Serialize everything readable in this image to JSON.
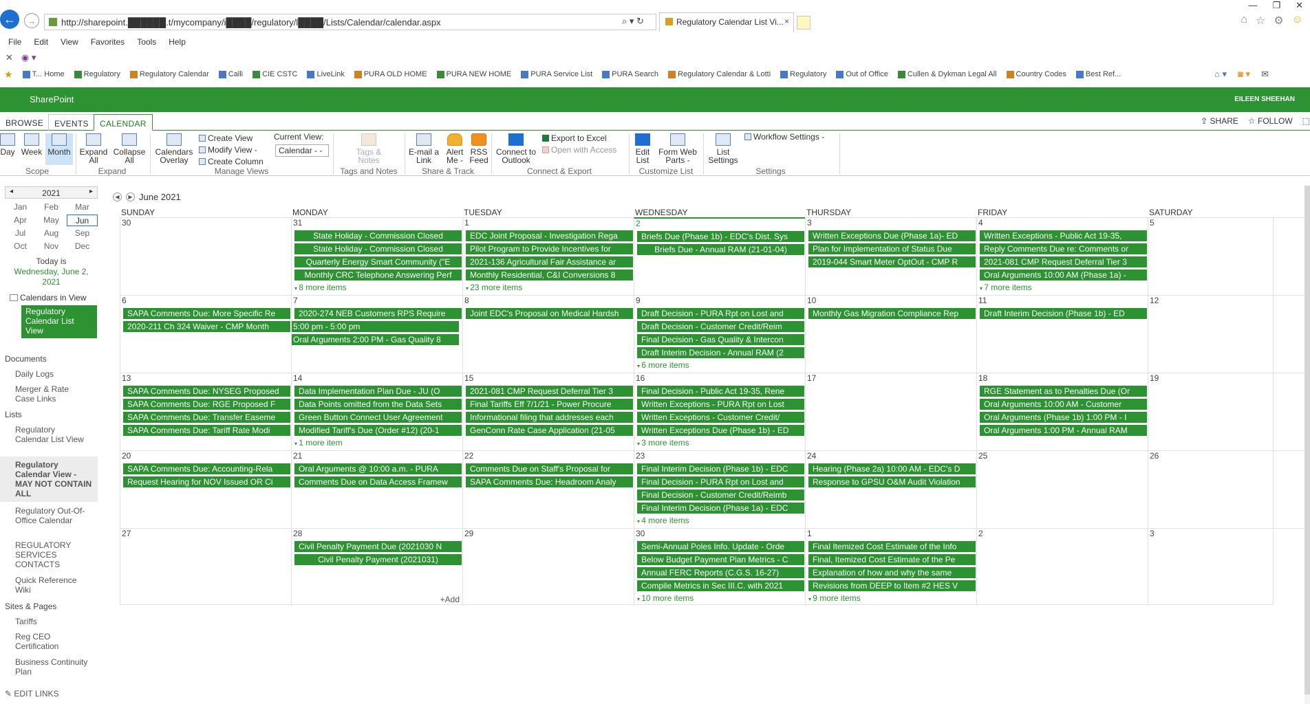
{
  "browser": {
    "url": "http://sharepoint.██████.t/mycompany/i████/regulatory/l████/Lists/Calendar/calendar.aspx",
    "tab_title": "Regulatory Calendar List Vi...",
    "menu": [
      "File",
      "Edit",
      "View",
      "Favorites",
      "Tools",
      "Help"
    ],
    "favorites": [
      "T... Home",
      "Regulatory",
      "Regulatory Calendar",
      "Calli",
      "CIE CSTC",
      "LiveLink",
      "PURA OLD HOME",
      "PURA NEW HOME",
      "PURA Service List",
      "PURA Search",
      "Regulatory Calendar & Lotti",
      "Regulatory",
      "Out of Office",
      "Cullen & Dykman Legal All",
      "Country Codes",
      "Best Ref..."
    ]
  },
  "suite": {
    "brand": "SharePoint",
    "user": "EILEEN SHEEHAN"
  },
  "ribbon": {
    "tabs": [
      "BROWSE",
      "EVENTS",
      "CALENDAR"
    ],
    "active_tab": "CALENDAR",
    "share": "SHARE",
    "follow": "FOLLOW",
    "scope": {
      "day": "Day",
      "week": "Week",
      "month": "Month",
      "label": "Scope"
    },
    "expand": {
      "expand_all": "Expand All",
      "collapse_all": "Collapse All",
      "label": "Expand"
    },
    "views": {
      "calendars_overlay": "Calendars Overlay",
      "create_view": "Create View",
      "modify_view": "Modify View -",
      "create_column": "Create Column",
      "current_view_label": "Current View:",
      "current_view": "Calendar - -",
      "label": "Manage Views"
    },
    "tags": {
      "tags_notes": "Tags & Notes",
      "label": "Tags and Notes"
    },
    "share_track": {
      "email_link": "E-mail a Link",
      "alert_me": "Alert Me -",
      "rss_feed": "RSS Feed",
      "label": "Share & Track"
    },
    "connect": {
      "connect_outlook": "Connect to Outlook",
      "export_excel": "Export to Excel",
      "open_access": "Open with Access",
      "label": "Connect & Export"
    },
    "customize": {
      "edit_list": "Edit List",
      "form_web_parts": "Form Web Parts -",
      "label": "Customize List"
    },
    "settings": {
      "list_settings": "List Settings",
      "workflow_settings": "Workflow Settings -",
      "label": "Settings"
    }
  },
  "datepicker": {
    "year": "2021",
    "months": [
      "Jan",
      "Feb",
      "Mar",
      "Apr",
      "May",
      "Jun",
      "Jul",
      "Aug",
      "Sep",
      "Oct",
      "Nov",
      "Dec"
    ],
    "selected_month": "Jun",
    "today_label": "Today is",
    "today_date": "Wednesday, June 2, 2021"
  },
  "calendars_in_view": {
    "label": "Calendars in View",
    "item": "Regulatory Calendar List View"
  },
  "leftnav": {
    "documents": "Documents",
    "daily_logs": "Daily Logs",
    "merger_rate": "Merger & Rate Case Links",
    "lists": "Lists",
    "reg_cal_list_view": "Regulatory Calendar List View",
    "reg_cal_view_selected": "Regulatory Calendar View - MAY NOT CONTAIN ALL",
    "reg_out_of_office": "Regulatory Out-Of-Office Calendar",
    "reg_services_contacts": "REGULATORY SERVICES CONTACTS",
    "quick_ref_wiki": "Quick Reference Wiki",
    "sites_pages": "Sites & Pages",
    "tariffs": "Tariffs",
    "reg_ceo_cert": "Reg CEO Certification",
    "business_continuity": "Business Continuity Plan",
    "edit_links": "EDIT LINKS"
  },
  "calendar": {
    "month_title": "June 2021",
    "weekdays": [
      "SUNDAY",
      "MONDAY",
      "TUESDAY",
      "WEDNESDAY",
      "THURSDAY",
      "FRIDAY",
      "SATURDAY"
    ],
    "add_label": "Add",
    "weeks": [
      [
        {
          "day": "30",
          "events": [],
          "more": ""
        },
        {
          "day": "31",
          "events": [
            "State Holiday - Commission Closed",
            "State Holiday - Commission Closed",
            "Quarterly Energy Smart Community (\"E",
            "Monthly CRC Telephone Answering Perf"
          ],
          "more": "8 more items"
        },
        {
          "day": "1",
          "events": [
            "EDC Joint Proposal - Investigation Rega",
            "Pilot Program to Provide Incentives for",
            "2021-136 Agricultural Fair Assistance ar",
            "Monthly Residential, C&I Conversions 8"
          ],
          "more": "23 more items"
        },
        {
          "day": "2",
          "events": [
            "Briefs Due (Phase 1b) - EDC's Dist. Sys",
            "Briefs Due - Annual RAM (21-01-04)"
          ],
          "more": ""
        },
        {
          "day": "3",
          "events": [
            "Written Exceptions Due (Phase 1a)- ED",
            "Plan for Implementation of Status Due",
            "2019-044 Smart Meter OptOut - CMP R"
          ],
          "more": ""
        },
        {
          "day": "4",
          "events": [
            "Written Exceptions - Public Act 19-35,",
            "Reply Comments Due re: Comments or",
            "2021-081 CMP Request Deferral Tier 3",
            "Oral Arguments 10:00 AM (Phase 1a) -"
          ],
          "more": "7 more items"
        },
        {
          "day": "5",
          "events": [],
          "more": ""
        }
      ],
      [
        {
          "day": "6",
          "events": [
            "SAPA Comments Due: More Specific Re",
            "2020-211 Ch 324 Waiver - CMP Month"
          ],
          "more": ""
        },
        {
          "day": "7",
          "events": [
            "2020-274 NEB Customers RPS Require",
            "5:00 pm - 5:00 pm",
            "Oral Arguments 2:00 PM - Gas Quality 8"
          ],
          "more": ""
        },
        {
          "day": "8",
          "events": [
            "Joint EDC's Proposal on Medical Hardsh"
          ],
          "more": ""
        },
        {
          "day": "9",
          "events": [
            "Draft Decision - PURA Rpt on Lost and",
            "Draft Decision - Customer Credit/Reim",
            "Final Decision - Gas Quality & Intercon",
            "Draft Interim Decision - Annual RAM (2"
          ],
          "more": "6 more items"
        },
        {
          "day": "10",
          "events": [
            "Monthly Gas Migration Compliance Rep"
          ],
          "more": ""
        },
        {
          "day": "11",
          "events": [
            "Draft Interim Decision (Phase 1b) - ED"
          ],
          "more": ""
        },
        {
          "day": "12",
          "events": [],
          "more": ""
        }
      ],
      [
        {
          "day": "13",
          "events": [
            "SAPA Comments Due: NYSEG Proposed",
            "SAPA Comments Due: RGE Proposed F",
            "SAPA Comments Due: Transfer Easeme",
            "SAPA Comments Due: Tariff Rate Modi"
          ],
          "more": ""
        },
        {
          "day": "14",
          "events": [
            "Data Implementation Plan Due - JU (O",
            "Data Points omitted from the Data Sets",
            "Green Button Connect User Agreement",
            "Modified Tariff's Due (Order #12) (20-1"
          ],
          "more": "1 more item"
        },
        {
          "day": "15",
          "events": [
            "2021-081 CMP Request Deferral Tier 3",
            "Final Tariffs Eff 7/1/21 - Power Procure",
            "Informational filing that addresses each",
            "GenConn Rate Case Application (21-05"
          ],
          "more": ""
        },
        {
          "day": "16",
          "events": [
            "Final Decision - Public Act 19-35, Rene",
            "Written Exceptions - PURA Rpt on Lost",
            "Written Exceptions - Customer Credit/",
            "Written Exceptions Due (Phase 1b) - ED"
          ],
          "more": "3 more items"
        },
        {
          "day": "17",
          "events": [],
          "more": ""
        },
        {
          "day": "18",
          "events": [
            "RGE Statement as to Penalties Due (Or",
            "Oral Arguments 10:00 AM - Customer",
            "Oral Arguments (Phase 1b) 1:00 PM - I",
            "Oral Arguments 1:00 PM - Annual RAM"
          ],
          "more": ""
        },
        {
          "day": "19",
          "events": [],
          "more": ""
        }
      ],
      [
        {
          "day": "20",
          "events": [
            "SAPA Comments Due: Accounting-Rela",
            "Request Hearing for NOV Issued OR Ci"
          ],
          "more": ""
        },
        {
          "day": "21",
          "events": [
            "Oral Arguments @ 10:00 a.m. - PURA",
            "Comments Due on Data Access Framew"
          ],
          "more": ""
        },
        {
          "day": "22",
          "events": [
            "Comments Due on Staff's Proposal for",
            "SAPA Comments Due: Headroom Analy"
          ],
          "more": ""
        },
        {
          "day": "23",
          "events": [
            "Final Interim Decision (Phase 1b) - EDC",
            "Final Decision - PURA Rpt on Lost and",
            "Final Decision - Customer Credit/Reimb",
            "Final Interim Decision (Phase 1a) - EDC"
          ],
          "more": "4 more items"
        },
        {
          "day": "24",
          "events": [
            "Hearing (Phase 2a) 10:00 AM - EDC's D",
            "Response to GPSU O&M Audit Violation"
          ],
          "more": ""
        },
        {
          "day": "25",
          "events": [],
          "more": ""
        },
        {
          "day": "26",
          "events": [],
          "more": ""
        }
      ],
      [
        {
          "day": "27",
          "events": [],
          "more": ""
        },
        {
          "day": "28",
          "events": [
            "Civil Penalty Payment Due (2021030 N",
            "Civil Penalty Payment (2021031)"
          ],
          "more": ""
        },
        {
          "day": "29",
          "events": [],
          "more": ""
        },
        {
          "day": "30",
          "events": [
            "Semi-Annual Poles Info. Update - Orde",
            "Below Budget Payment Plan Metrics - C",
            "Annual FERC Reports (C.G.S. 16-27)",
            "Compile Metrics in Sec III.C. with 2021"
          ],
          "more": "10 more items"
        },
        {
          "day": "1",
          "events": [
            "Final Itemized Cost Estimate of the Info",
            "Final, Itemized Cost Estimate of the Pe",
            "Explanation of how and why the same",
            "Revisions from DEEP to Item #2 HES V"
          ],
          "more": "9 more items"
        },
        {
          "day": "2",
          "events": [],
          "more": ""
        },
        {
          "day": "3",
          "events": [],
          "more": ""
        }
      ]
    ]
  }
}
